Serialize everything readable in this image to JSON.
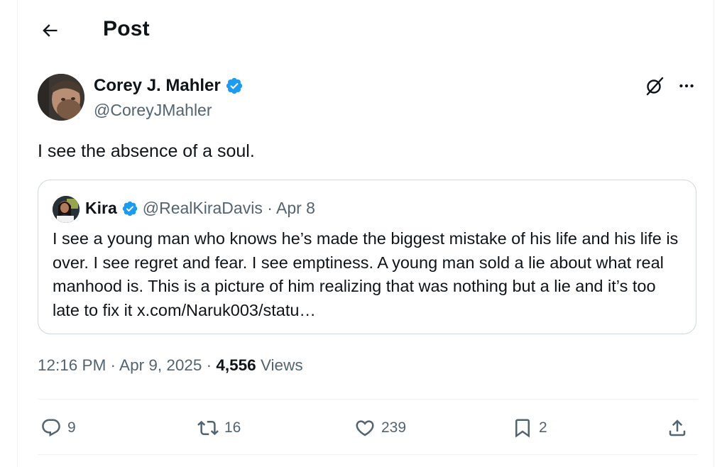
{
  "header": {
    "title": "Post",
    "back_icon": "arrow-left-icon"
  },
  "post": {
    "author": {
      "name": "Corey J. Mahler",
      "handle": "@CoreyJMahler",
      "verified": true
    },
    "text": "I see the absence of a soul.",
    "timestamp": "12:16 PM · Apr 9, 2025 · ",
    "views_count": "4,556",
    "views_label": " Views"
  },
  "quote": {
    "author_name": "Kira",
    "handle_date": "@RealKiraDavis · Apr 8",
    "text": "I see a young man who knows he’s made the biggest mistake of his life and his life is over. I see regret and fear. I see emptiness. A young man sold a lie about what real manhood is. This is a picture of him realizing that was nothing but a lie and it’s too late to fix it x.com/Naruk003/statu…"
  },
  "actions": {
    "replies": "9",
    "reposts": "16",
    "likes": "239",
    "bookmarks": "2"
  },
  "colors": {
    "accent": "#1d9bf0",
    "text": "#0f1419",
    "muted": "#536471",
    "border": "#cfd9de"
  }
}
